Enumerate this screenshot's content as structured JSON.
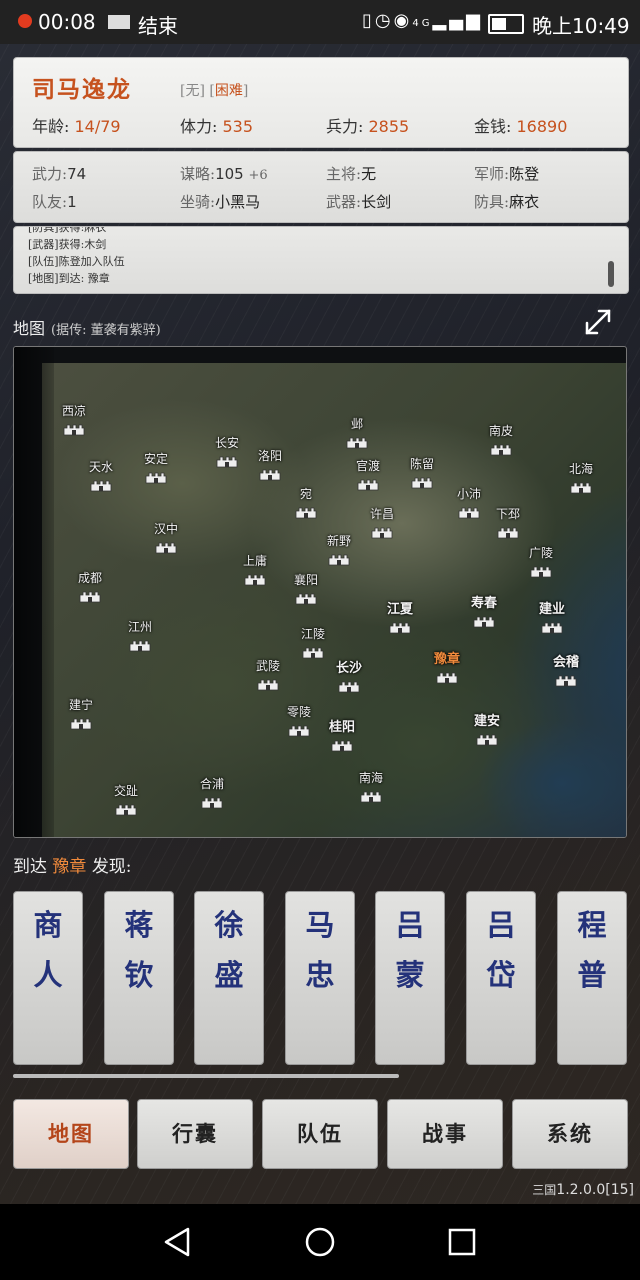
{
  "status_bar": {
    "time": "00:08",
    "app_label": "结束",
    "clock": "晚上10:49",
    "network": "4G"
  },
  "hero": {
    "name": "司马逸龙",
    "tag_open": "[",
    "title": "无",
    "tag_close": "]",
    "difficulty": "困难",
    "age_label": "年龄:",
    "age": "14",
    "age_max": "/79",
    "stamina_label": "体力:",
    "stamina": "535",
    "troops_label": "兵力:",
    "troops": "2855",
    "gold_label": "金钱:",
    "gold": "16890"
  },
  "attributes": {
    "force_label": "武力:",
    "force": "74",
    "strategy_label": "谋略:",
    "strategy": "105",
    "strategy_bonus": "+6",
    "general_label": "主将:",
    "general": "无",
    "advisor_label": "军师:",
    "advisor": "陈登",
    "teammates_label": "队友:",
    "teammates": "1",
    "mount_label": "坐骑:",
    "mount": "小黑马",
    "weapon_label": "武器:",
    "weapon": "长剑",
    "armor_label": "防具:",
    "armor": "麻衣"
  },
  "log": [
    "[防具]获得:麻衣",
    "[武器]获得:木剑",
    "[队伍]陈登加入队伍",
    "[地图]到达: 豫章"
  ],
  "map_section": {
    "title": "地图",
    "note": "(据传: 董袭有紫骍)"
  },
  "cities": [
    {
      "name": "西凉"
    },
    {
      "name": "邺"
    },
    {
      "name": "南皮"
    },
    {
      "name": "长安"
    },
    {
      "name": "洛阳"
    },
    {
      "name": "天水"
    },
    {
      "name": "安定"
    },
    {
      "name": "官渡"
    },
    {
      "name": "陈留"
    },
    {
      "name": "北海"
    },
    {
      "name": "宛"
    },
    {
      "name": "小沛"
    },
    {
      "name": "许昌"
    },
    {
      "name": "下邳"
    },
    {
      "name": "汉中"
    },
    {
      "name": "新野"
    },
    {
      "name": "广陵"
    },
    {
      "name": "上庸"
    },
    {
      "name": "成都"
    },
    {
      "name": "襄阳"
    },
    {
      "name": "江夏"
    },
    {
      "name": "寿春"
    },
    {
      "name": "建业"
    },
    {
      "name": "江州"
    },
    {
      "name": "江陵"
    },
    {
      "name": "豫章"
    },
    {
      "name": "武陵"
    },
    {
      "name": "长沙"
    },
    {
      "name": "会稽"
    },
    {
      "name": "建宁"
    },
    {
      "name": "零陵"
    },
    {
      "name": "桂阳"
    },
    {
      "name": "建安"
    },
    {
      "name": "南海"
    },
    {
      "name": "合浦"
    },
    {
      "name": "交趾"
    }
  ],
  "current_city": "豫章",
  "discovery": {
    "prefix": "到达",
    "place": "豫章",
    "suffix": "发现:"
  },
  "npcs": [
    {
      "line1": "商",
      "line2": "人"
    },
    {
      "line1": "蒋",
      "line2": "钦"
    },
    {
      "line1": "徐",
      "line2": "盛"
    },
    {
      "line1": "马",
      "line2": "忠"
    },
    {
      "line1": "吕",
      "line2": "蒙"
    },
    {
      "line1": "吕",
      "line2": "岱"
    },
    {
      "line1": "程",
      "line2": "普"
    }
  ],
  "nav": {
    "map": "地图",
    "bag": "行囊",
    "team": "队伍",
    "battle": "战事",
    "system": "系统",
    "active": "map"
  },
  "version": {
    "prefix": "三国",
    "number": "1.2.0.0[15]"
  },
  "colors": {
    "accent": "#c6521e",
    "current_city": "#f08a3c",
    "npc_text": "#24327a"
  }
}
